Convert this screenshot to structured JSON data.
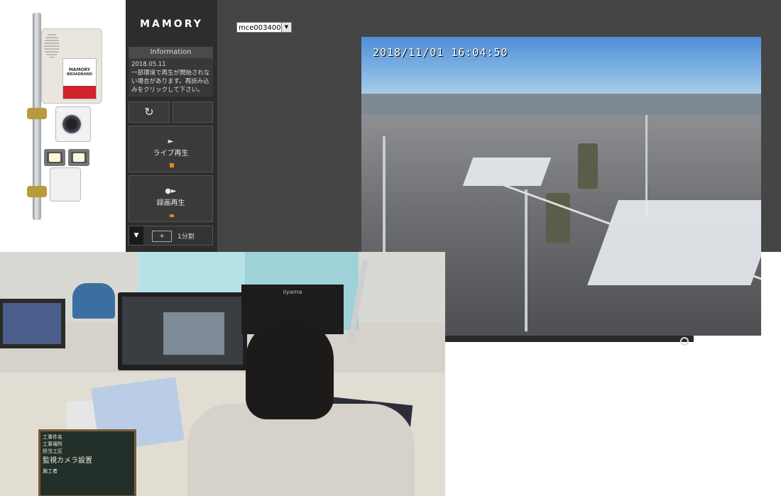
{
  "device_photo": {
    "brand_label": "MAMORY",
    "sub_label": "BROADBAND"
  },
  "viewer": {
    "logo": "MAMORY",
    "info": {
      "header": "Information",
      "date": "2018.05.11",
      "message": "一部環境で再生が開始されない場合があります。再読み込みをクリックして下さい。"
    },
    "controls": {
      "refresh_icon": "refresh-icon",
      "live": {
        "glyph": "►",
        "label": "ライブ再生"
      },
      "recorded": {
        "glyph": "●►",
        "label": "録画再生"
      },
      "split_toggle": "▼",
      "split_add": "+",
      "split_label": "1分割"
    },
    "camera_select": {
      "value": "mce003400"
    },
    "feed": {
      "timestamp": "2018/11/01  16:04:50"
    }
  },
  "office_photo": {
    "board_lines": [
      "工事件名",
      "工事場所",
      "担当工区",
      "監視カメラ設置",
      "施工者"
    ],
    "monitor_brand": "iiyama"
  },
  "colors": {
    "viewer_bg": "#454545",
    "sidebar_bg": "#2d2d2d",
    "accent": "#e08a15"
  }
}
